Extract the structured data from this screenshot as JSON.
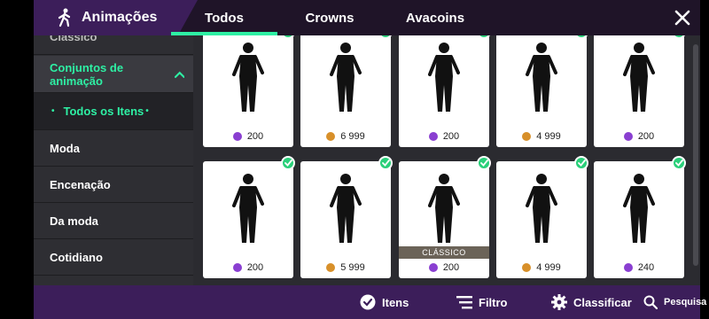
{
  "header": {
    "section_title": "Animações",
    "tabs": [
      {
        "label": "Todos",
        "active": true
      },
      {
        "label": "Crowns",
        "active": false
      },
      {
        "label": "Avacoins",
        "active": false
      }
    ],
    "accent_color": "#2ef0a4"
  },
  "sidebar": {
    "cut_item": "Clássico",
    "group_label": "Conjuntos de animação",
    "sub_label": "Todos os Itens",
    "items": [
      "Moda",
      "Encenação",
      "Da moda",
      "Cotidiano"
    ]
  },
  "grid": {
    "cards": [
      {
        "price": "200",
        "currency": "crown",
        "owned": true,
        "badge": ""
      },
      {
        "price": "6 999",
        "currency": "avacoin",
        "owned": true,
        "badge": ""
      },
      {
        "price": "200",
        "currency": "crown",
        "owned": true,
        "badge": ""
      },
      {
        "price": "4 999",
        "currency": "avacoin",
        "owned": true,
        "badge": ""
      },
      {
        "price": "200",
        "currency": "crown",
        "owned": true,
        "badge": ""
      },
      {
        "price": "200",
        "currency": "crown",
        "owned": true,
        "badge": ""
      },
      {
        "price": "5 999",
        "currency": "avacoin",
        "owned": true,
        "badge": ""
      },
      {
        "price": "200",
        "currency": "crown",
        "owned": true,
        "badge": "CLÁSSICO"
      },
      {
        "price": "4 999",
        "currency": "avacoin",
        "owned": true,
        "badge": ""
      },
      {
        "price": "240",
        "currency": "crown",
        "owned": true,
        "badge": ""
      }
    ]
  },
  "bottom_bar": {
    "items_label": "Itens",
    "filter_label": "Filtro",
    "sort_label": "Classificar",
    "search_label": "Pesquisa"
  }
}
